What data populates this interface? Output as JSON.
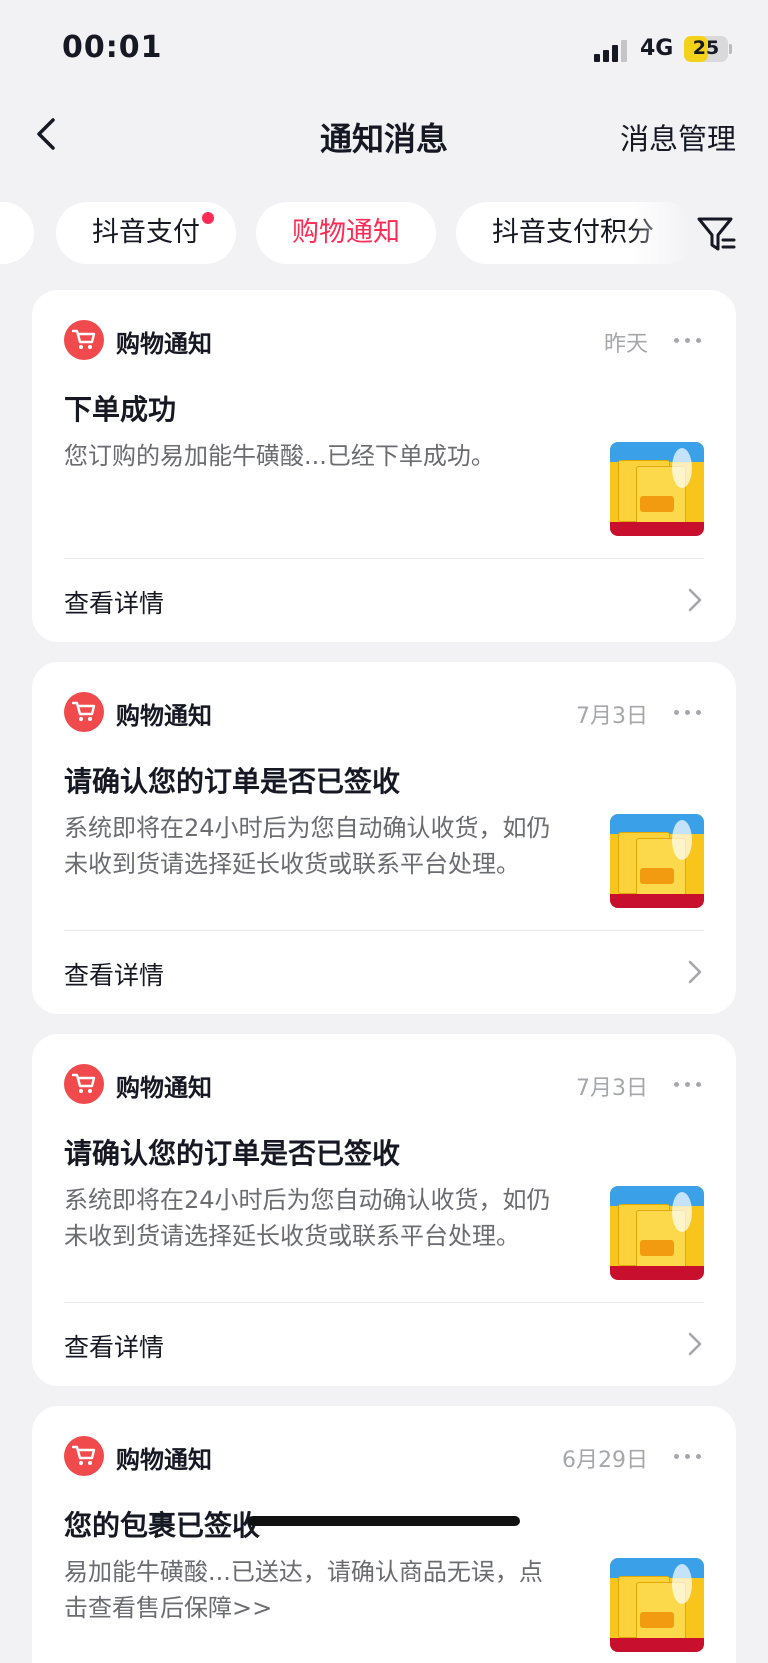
{
  "status_bar": {
    "time": "00:01",
    "network": "4G",
    "battery": "25",
    "battery_level": 0.25
  },
  "nav": {
    "title": "通知消息",
    "manage_label": "消息管理"
  },
  "tabs": [
    {
      "label": "",
      "active": false
    },
    {
      "label": "抖音支付",
      "active": false,
      "dot": true
    },
    {
      "label": "购物通知",
      "active": true
    },
    {
      "label": "抖音支付积分",
      "active": false
    }
  ],
  "cards": [
    {
      "source": "购物通知",
      "time": "昨天",
      "title": "下单成功",
      "body": "您订购的易加能牛磺酸...已经下单成功。",
      "detail": "查看详情"
    },
    {
      "source": "购物通知",
      "time": "7月3日",
      "title": "请确认您的订单是否已签收",
      "body": "系统即将在24小时后为您自动确认收货，如仍未收到货请选择延长收货或联系平台处理。",
      "detail": "查看详情"
    },
    {
      "source": "购物通知",
      "time": "7月3日",
      "title": "请确认您的订单是否已签收",
      "body": "系统即将在24小时后为您自动确认收货，如仍未收到货请选择延长收货或联系平台处理。",
      "detail": "查看详情"
    },
    {
      "source": "购物通知",
      "time": "6月29日",
      "title": "您的包裹已签收",
      "body": "易加能牛磺酸...已送达，请确认商品无误，点击查看售后保障>>",
      "detail": ""
    }
  ],
  "icons": {
    "back": "chevron-left-icon",
    "filter": "filter-icon",
    "source": "cart-icon",
    "more": "more-icon",
    "arrow": "chevron-right-icon"
  },
  "colors": {
    "accent": "#fe2c55",
    "cart_badge": "#f04a4d",
    "background": "#f2f2f5"
  }
}
